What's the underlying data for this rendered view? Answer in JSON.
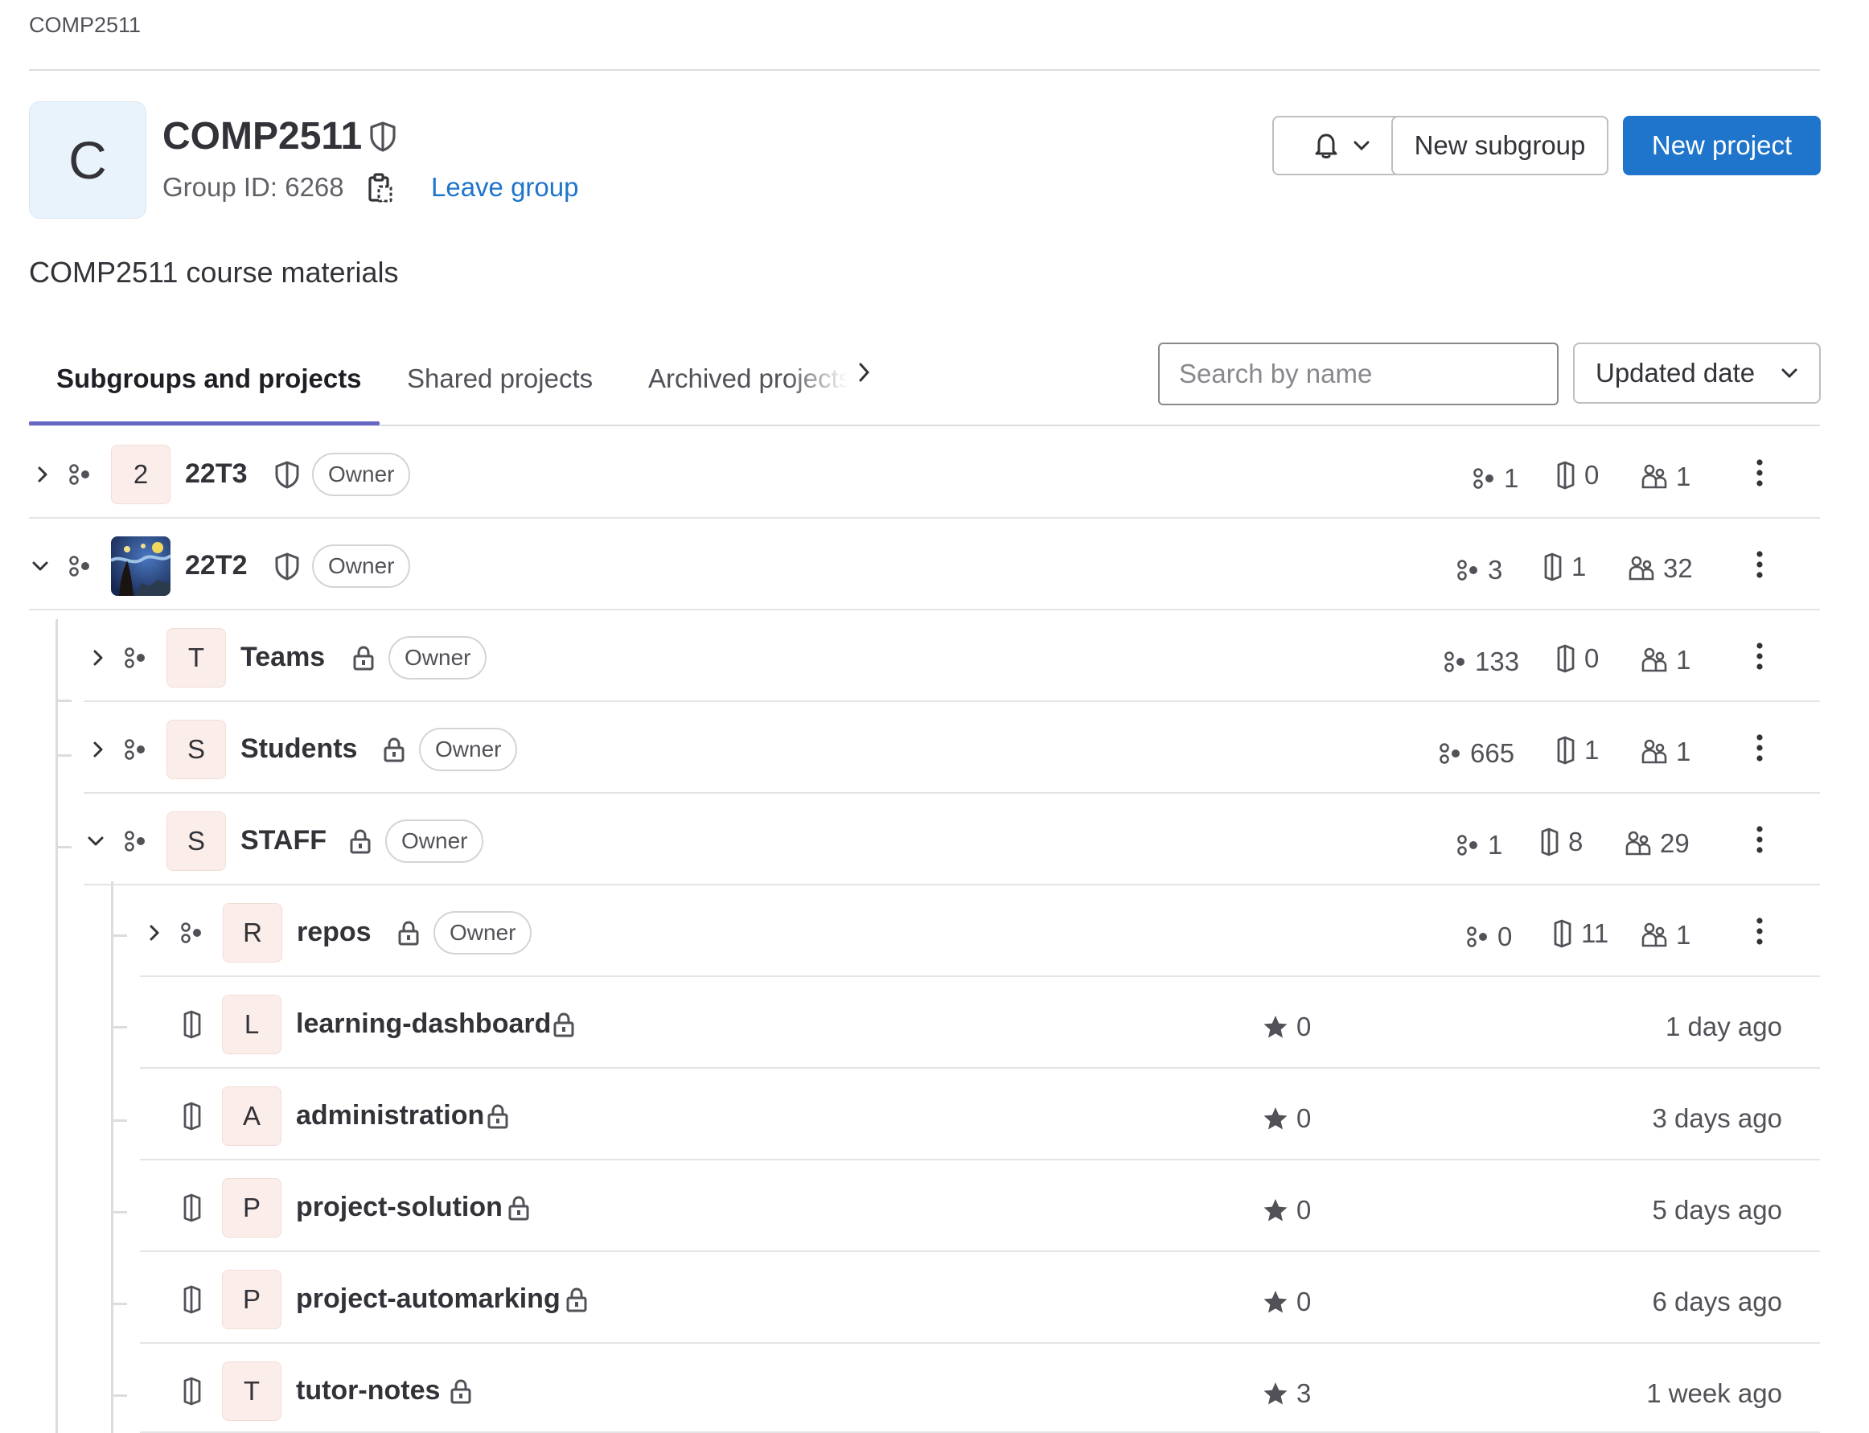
{
  "breadcrumb": "COMP2511",
  "group": {
    "avatar_letter": "C",
    "title": "COMP2511",
    "group_id": "Group ID: 6268",
    "leave_label": "Leave group",
    "description": "COMP2511 course materials"
  },
  "actions": {
    "new_subgroup": "New subgroup",
    "new_project": "New project"
  },
  "tabs": [
    {
      "label": "Subgroups and projects",
      "active": true
    },
    {
      "label": "Shared projects",
      "active": false
    },
    {
      "label": "Archived projects",
      "active": false
    }
  ],
  "search": {
    "placeholder": "Search by name"
  },
  "sort": {
    "label": "Updated date"
  },
  "rows": {
    "r0": {
      "avatar": "2",
      "name": "22T3",
      "role": "Owner",
      "subgroups": "1",
      "projects": "0",
      "members": "1"
    },
    "r1": {
      "avatar": "",
      "name": "22T2",
      "role": "Owner",
      "subgroups": "3",
      "projects": "1",
      "members": "32"
    },
    "r2": {
      "avatar": "T",
      "name": "Teams",
      "role": "Owner",
      "subgroups": "133",
      "projects": "0",
      "members": "1"
    },
    "r3": {
      "avatar": "S",
      "name": "Students",
      "role": "Owner",
      "subgroups": "665",
      "projects": "1",
      "members": "1"
    },
    "r4": {
      "avatar": "S",
      "name": "STAFF",
      "role": "Owner",
      "subgroups": "1",
      "projects": "8",
      "members": "29"
    },
    "r5": {
      "avatar": "R",
      "name": "repos",
      "role": "Owner",
      "subgroups": "0",
      "projects": "11",
      "members": "1"
    },
    "p0": {
      "avatar": "L",
      "name": "learning-dashboard",
      "stars": "0",
      "updated": "1 day ago"
    },
    "p1": {
      "avatar": "A",
      "name": "administration",
      "stars": "0",
      "updated": "3 days ago"
    },
    "p2": {
      "avatar": "P",
      "name": "project-solution",
      "stars": "0",
      "updated": "5 days ago"
    },
    "p3": {
      "avatar": "P",
      "name": "project-automarking",
      "stars": "0",
      "updated": "6 days ago"
    },
    "p4": {
      "avatar": "T",
      "name": "tutor-notes",
      "stars": "3",
      "updated": "1 week ago"
    }
  },
  "colors": {
    "primary": "#1f75cb",
    "tab_underline": "#6666c4",
    "avatar_bg": "#fbeeea",
    "group_avatar_bg": "#e9f3fc"
  }
}
